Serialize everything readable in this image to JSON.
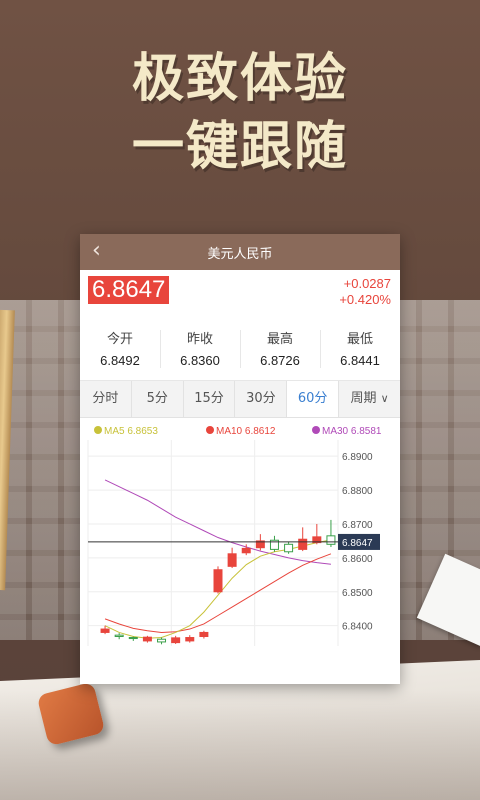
{
  "headline": {
    "line1": "极致体验",
    "line2": "一键跟随"
  },
  "app": {
    "title": "美元人民币"
  },
  "quote": {
    "price": "6.8647",
    "change": "+0.0287",
    "change_pct": "+0.420%"
  },
  "stats": [
    {
      "label": "今开",
      "value": "6.8492"
    },
    {
      "label": "昨收",
      "value": "6.8360"
    },
    {
      "label": "最高",
      "value": "6.8726"
    },
    {
      "label": "最低",
      "value": "6.8441"
    }
  ],
  "tabs": [
    {
      "label": "分时",
      "active": false
    },
    {
      "label": "5分",
      "active": false
    },
    {
      "label": "15分",
      "active": false
    },
    {
      "label": "30分",
      "active": false
    },
    {
      "label": "60分",
      "active": true
    },
    {
      "label": "周期",
      "active": false
    }
  ],
  "colors": {
    "up": "#e8453c",
    "down": "#3aa04a",
    "ma5": "#c8c23a",
    "ma10": "#e8453c",
    "ma30": "#b04ab8"
  },
  "chart_data": {
    "type": "line",
    "legend": [
      {
        "name": "MA5",
        "value": "6.8653"
      },
      {
        "name": "MA10",
        "value": "6.8612"
      },
      {
        "name": "MA30",
        "value": "6.8581"
      }
    ],
    "y_ticks": [
      "6.8900",
      "6.8800",
      "6.8700",
      "6.8600",
      "6.8500",
      "6.8400"
    ],
    "ylim": [
      6.834,
      6.893
    ],
    "last_price": "6.8647",
    "candles": [
      {
        "o": 6.838,
        "c": 6.839,
        "h": 6.84,
        "l": 6.8375
      },
      {
        "o": 6.8372,
        "c": 6.8368,
        "h": 6.8378,
        "l": 6.836
      },
      {
        "o": 6.8365,
        "c": 6.8362,
        "h": 6.8368,
        "l": 6.8355
      },
      {
        "o": 6.8355,
        "c": 6.8366,
        "h": 6.837,
        "l": 6.835
      },
      {
        "o": 6.836,
        "c": 6.8352,
        "h": 6.8365,
        "l": 6.8345
      },
      {
        "o": 6.835,
        "c": 6.8364,
        "h": 6.837,
        "l": 6.8346
      },
      {
        "o": 6.8355,
        "c": 6.8365,
        "h": 6.8372,
        "l": 6.835
      },
      {
        "o": 6.8368,
        "c": 6.838,
        "h": 6.8385,
        "l": 6.8362
      },
      {
        "o": 6.85,
        "c": 6.8565,
        "h": 6.8575,
        "l": 6.8495
      },
      {
        "o": 6.8575,
        "c": 6.8612,
        "h": 6.863,
        "l": 6.857
      },
      {
        "o": 6.8615,
        "c": 6.8628,
        "h": 6.864,
        "l": 6.8608
      },
      {
        "o": 6.863,
        "c": 6.865,
        "h": 6.867,
        "l": 6.8622
      },
      {
        "o": 6.8652,
        "c": 6.8625,
        "h": 6.8665,
        "l": 6.8618
      },
      {
        "o": 6.864,
        "c": 6.8618,
        "h": 6.8648,
        "l": 6.8612
      },
      {
        "o": 6.8625,
        "c": 6.8655,
        "h": 6.869,
        "l": 6.862
      },
      {
        "o": 6.8645,
        "c": 6.8662,
        "h": 6.87,
        "l": 6.864
      },
      {
        "o": 6.8665,
        "c": 6.864,
        "h": 6.8712,
        "l": 6.8632
      }
    ],
    "ma5": [
      6.84,
      6.838,
      6.8368,
      6.8363,
      6.8365,
      6.838,
      6.84,
      6.844,
      6.849,
      6.854,
      6.858,
      6.8605,
      6.8618,
      6.8625,
      6.8635,
      6.8645,
      6.8653
    ],
    "ma10": [
      6.842,
      6.8405,
      6.8392,
      6.8385,
      6.838,
      6.8382,
      6.839,
      6.8405,
      6.843,
      6.8455,
      6.848,
      6.8505,
      6.853,
      6.8555,
      6.8578,
      6.8596,
      6.8612
    ],
    "ma30": [
      6.883,
      6.881,
      6.879,
      6.877,
      6.8745,
      6.872,
      6.87,
      6.868,
      6.866,
      6.8645,
      6.8632,
      6.862,
      6.861,
      6.86,
      6.8592,
      6.8586,
      6.8581
    ]
  }
}
